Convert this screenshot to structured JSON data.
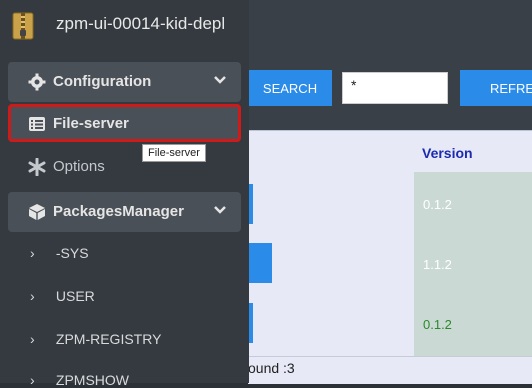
{
  "app": {
    "title": "zpm-ui-00014-kid-depl"
  },
  "sidebar": {
    "configuration_label": "Configuration",
    "file_server_label": "File-server",
    "options_label": "Options",
    "packages_manager_label": "PackagesManager",
    "sub_items": [
      "-SYS",
      "USER",
      "ZPM-REGISTRY",
      "ZPMSHOW"
    ]
  },
  "tooltip": {
    "text": "File-server"
  },
  "toolbar": {
    "search_label": "SEARCH",
    "search_value": "*",
    "refresh_label": "REFRES"
  },
  "table": {
    "version_header": "Version",
    "versions": [
      "0.1.2",
      "1.1.2",
      "0.1.2"
    ]
  },
  "footer": {
    "text": "ound :3"
  },
  "colors": {
    "accent": "#2a8be8",
    "sidebar_bg": "#343a40",
    "highlight": "#d01a1a",
    "version_header": "#1a2bb0",
    "version_green": "#2a8a2a"
  }
}
